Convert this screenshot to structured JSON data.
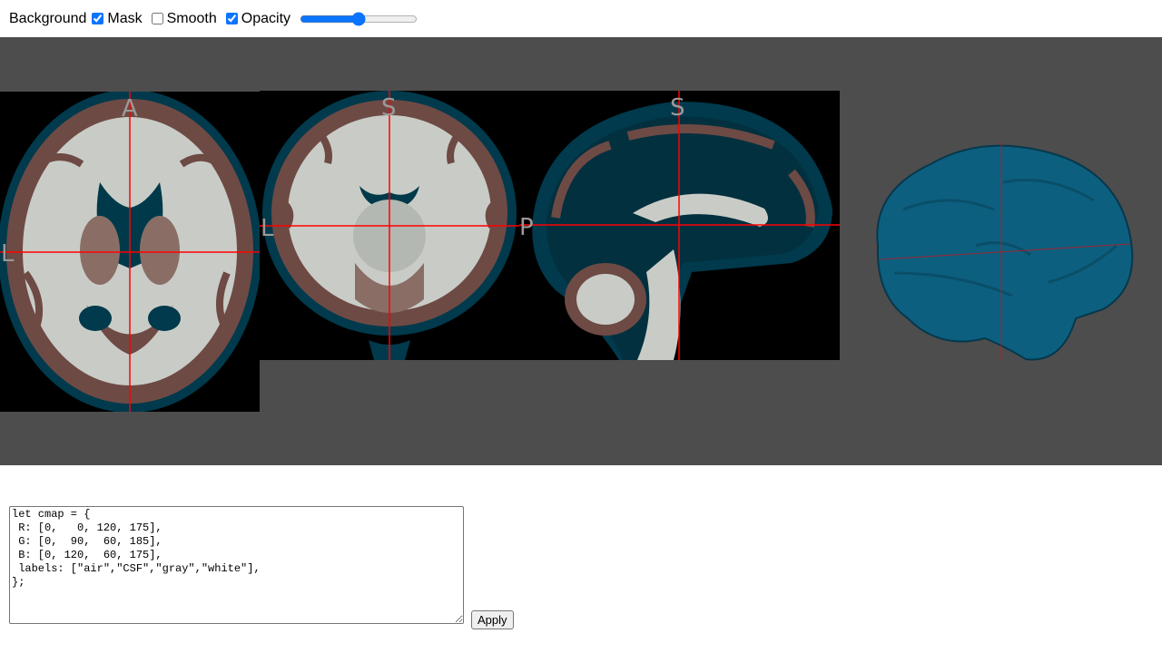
{
  "toolbar": {
    "background_label": "Background",
    "mask_label": "Mask",
    "mask_checked": true,
    "smooth_label": "Smooth",
    "smooth_checked": false,
    "opacity_label": "Opacity",
    "opacity_value": 50
  },
  "views": {
    "axial": {
      "top": "A",
      "left": "L"
    },
    "coronal": {
      "top": "S",
      "left": "L"
    },
    "sagittal": {
      "top": "S",
      "left": "P"
    }
  },
  "colors": {
    "viewer_bg": "#4d4d4d",
    "crosshair": "#ff0000",
    "csf": "#005a78",
    "gray": "#785a3c",
    "white": "#afb9af",
    "accent": "#0b74ff"
  },
  "editor": {
    "code": "let cmap = {\n R: [0,   0, 120, 175],\n G: [0,  90,  60, 185],\n B: [0, 120,  60, 175],\n labels: [\"air\",\"CSF\",\"gray\",\"white\"],\n};"
  },
  "apply_label": "Apply"
}
